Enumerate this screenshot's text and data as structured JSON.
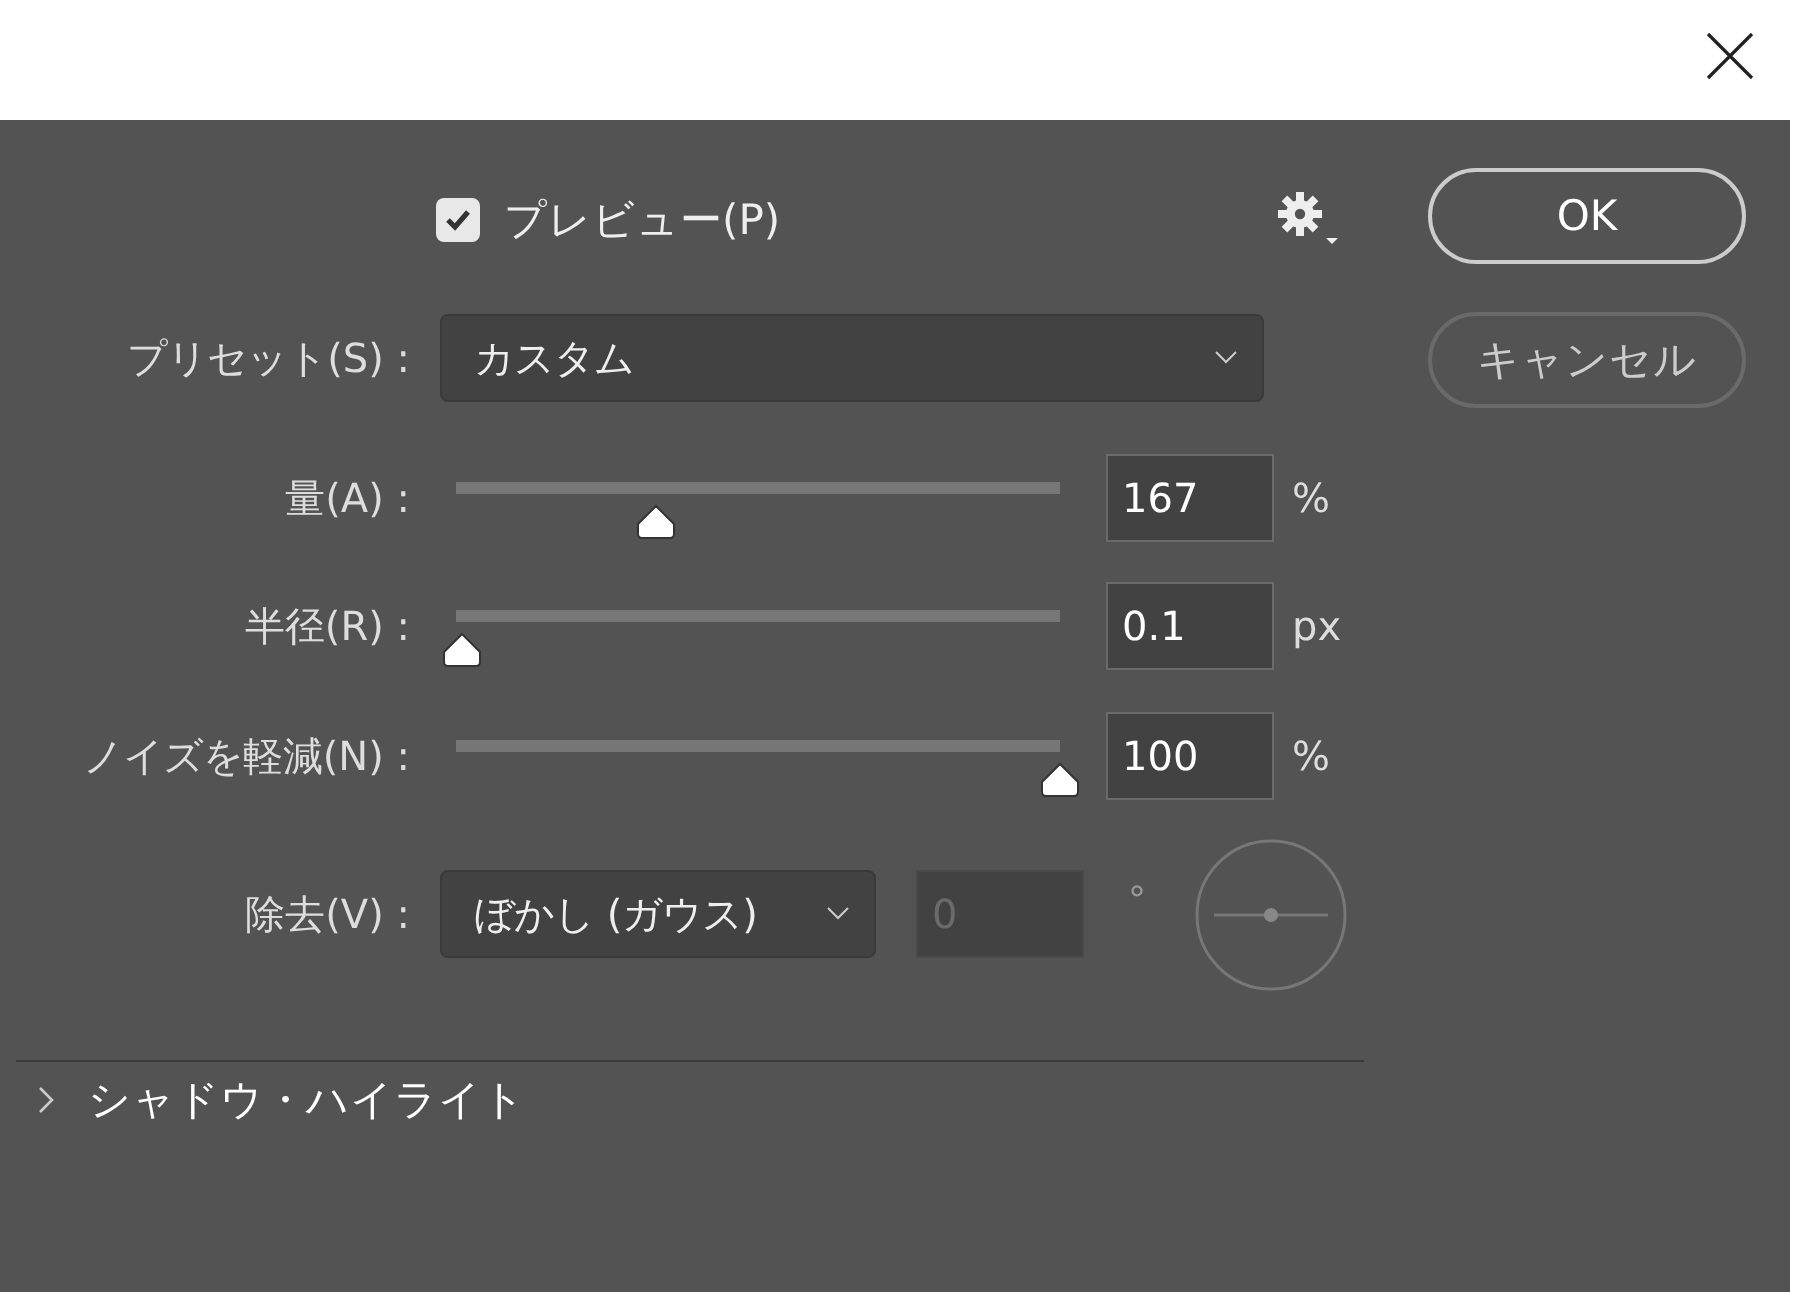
{
  "preview": {
    "label": "プレビュー(P)",
    "checked": true
  },
  "preset": {
    "label": "プリセット(S) :",
    "value": "カスタム"
  },
  "sliders": [
    {
      "label": "量(A) :",
      "level": 0.33,
      "value": "167",
      "unit": "%"
    },
    {
      "label": "半径(R) :",
      "level": 0.01,
      "value": "0.1",
      "unit": "px"
    },
    {
      "label": "ノイズを軽減(N) :",
      "level": 1.0,
      "value": "100",
      "unit": "%"
    }
  ],
  "remove": {
    "label": "除去(V) :",
    "value": "ぼかし (ガウス)",
    "angle": {
      "value": "0",
      "unit": "°",
      "disabled": true
    }
  },
  "section": {
    "label": "シャドウ・ハイライト",
    "expanded": false
  },
  "buttons": [
    {
      "label": "OK",
      "kind": "default"
    },
    {
      "label": "キャンセル",
      "kind": "normal"
    }
  ]
}
